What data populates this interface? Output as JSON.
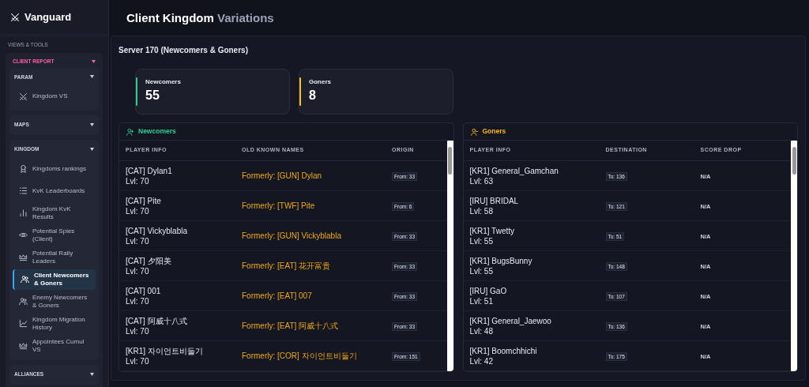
{
  "sidebar": {
    "brand": "Vanguard",
    "section_label": "VIEWS & TOOLS",
    "groups": [
      {
        "label": "CLIENT REPORT",
        "subgroups": [
          {
            "label": "PARAM",
            "items": [
              {
                "label": "Kingdom VS",
                "kind": "swords",
                "selected": false
              }
            ]
          },
          {
            "label": "MAPS"
          },
          {
            "label": "KINGDOM",
            "items": [
              {
                "label": "Kingdoms rankings",
                "kind": "ribbon",
                "selected": false
              },
              {
                "label": "KvK Leaderboards",
                "kind": "list",
                "selected": false
              },
              {
                "label": "Kingdom KvK Results",
                "kind": "bars",
                "selected": false
              },
              {
                "label": "Potential Spies (Client)",
                "kind": "eye",
                "selected": false
              },
              {
                "label": "Potential Rally Leaders",
                "kind": "crown",
                "selected": false
              },
              {
                "label": "Client Newcomers & Goners",
                "kind": "people",
                "selected": true
              },
              {
                "label": "Enemy Newcomers & Goners",
                "kind": "people",
                "selected": false
              },
              {
                "label": "Kingdom Migration History",
                "kind": "chart",
                "selected": false
              },
              {
                "label": "Appointees Cumul VS",
                "kind": "crown",
                "selected": false
              }
            ]
          },
          {
            "label": "ALLIANCES"
          }
        ]
      }
    ]
  },
  "page_title": {
    "main": "Client Kingdom ",
    "accent": "Variations"
  },
  "server_title": "Server 170 (Newcomers & Goners)",
  "stats": [
    {
      "label": "Newcomers",
      "value": "55",
      "color": "#2ecc8f"
    },
    {
      "label": "Goners",
      "value": "8",
      "color": "#f5c518"
    }
  ],
  "newcomers": {
    "title": "Newcomers",
    "columns": [
      "PLAYER INFO",
      "OLD KNOWN NAMES",
      "ORIGIN"
    ],
    "rows": [
      {
        "player": "[CAT] Dylan1",
        "level": "Lvl: 70",
        "former": "Formerly: [GUN] Dylan",
        "origin": "From: 33"
      },
      {
        "player": "[CAT] Pite",
        "level": "Lvl: 70",
        "former": "Formerly: [TWF] Pite",
        "origin": "From: 6"
      },
      {
        "player": "[CAT] Vickyblabla",
        "level": "Lvl: 70",
        "former": "Formerly: [GUN] Vickyblabla",
        "origin": "From: 33"
      },
      {
        "player": "[CAT] 夕阳美",
        "level": "Lvl: 70",
        "former": "Formerly: [EAT] 花开富贵",
        "origin": "From: 33"
      },
      {
        "player": "[CAT] 001",
        "level": "Lvl: 70",
        "former": "Formerly: [EAT] 007",
        "origin": "From: 33"
      },
      {
        "player": "[CAT] 阿威十八式",
        "level": "Lvl: 70",
        "former": "Formerly: [EAT] 阿威十八式",
        "origin": "From: 33"
      },
      {
        "player": "[KR1] 자이언트비둘기",
        "level": "Lvl: 70",
        "former": "Formerly: [COR] 자이언트비둘기",
        "origin": "From: 151"
      }
    ]
  },
  "goners": {
    "title": "Goners",
    "columns": [
      "PLAYER INFO",
      "DESTINATION",
      "SCORE DROP"
    ],
    "rows": [
      {
        "player": "[KR1] General_Gamchan",
        "level": "Lvl: 63",
        "destination": "To: 136",
        "score_drop": "N/A"
      },
      {
        "player": "[IRU] BRIDAL",
        "level": "Lvl: 58",
        "destination": "To: 121",
        "score_drop": "N/A"
      },
      {
        "player": "[KR1] Twetty",
        "level": "Lvl: 55",
        "destination": "To: 51",
        "score_drop": "N/A"
      },
      {
        "player": "[KR1] BugsBunny",
        "level": "Lvl: 55",
        "destination": "To: 148",
        "score_drop": "N/A"
      },
      {
        "player": "[IRU] GaO",
        "level": "Lvl: 51",
        "destination": "To: 107",
        "score_drop": "N/A"
      },
      {
        "player": "[KR1] General_Jaewoo",
        "level": "Lvl: 48",
        "destination": "To: 136",
        "score_drop": "N/A"
      },
      {
        "player": "[KR1] Boomchhichi",
        "level": "Lvl: 42",
        "destination": "To: 175",
        "score_drop": "N/A"
      }
    ]
  }
}
